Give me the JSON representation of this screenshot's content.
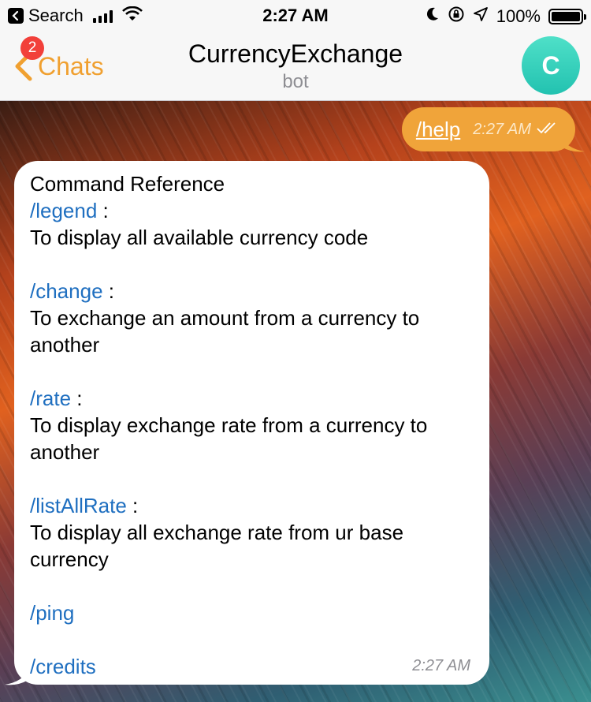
{
  "status_bar": {
    "back_app_label": "Search",
    "time": "2:27 AM",
    "battery_percent": "100%",
    "icons": [
      "signal-icon",
      "wifi-icon",
      "moon-icon",
      "rotation-lock-icon",
      "location-icon",
      "battery-icon"
    ]
  },
  "nav": {
    "back_label": "Chats",
    "unread_badge": "2",
    "title": "CurrencyExchange",
    "subtitle": "bot",
    "avatar_letter": "C",
    "avatar_color": "#2fd0bc",
    "accent_color": "#f0a030"
  },
  "messages": {
    "outgoing": {
      "text": "/help",
      "time": "2:27 AM",
      "bubble_color": "#f0a43a"
    },
    "incoming": {
      "heading": "Command Reference",
      "commands": [
        {
          "cmd": "/legend",
          "sep": " :",
          "desc": "To display all available currency code"
        },
        {
          "cmd": "/change",
          "sep": " :",
          "desc": "To exchange an amount from a currency to another"
        },
        {
          "cmd": "/rate",
          "sep": " :",
          "desc": "To display exchange rate from a currency to another"
        },
        {
          "cmd": "/listAllRate",
          "sep": " :",
          "desc": "To display all exchange rate from ur base currency"
        },
        {
          "cmd": "/ping"
        },
        {
          "cmd": "/credits"
        }
      ],
      "time": "2:27 AM",
      "link_color": "#1f6fc0"
    }
  }
}
